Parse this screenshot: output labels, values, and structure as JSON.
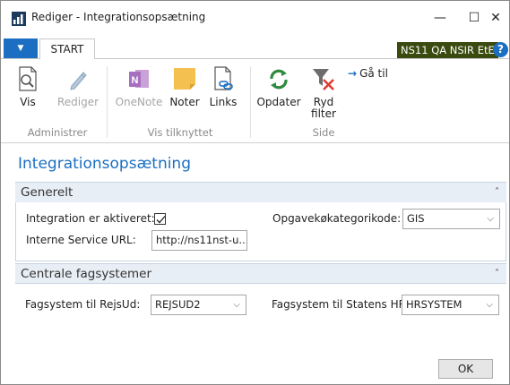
{
  "window": {
    "title": "Rediger - Integrationsopsætning",
    "minimize_glyph": "—",
    "maximize_glyph": "☐",
    "close_glyph": "✕"
  },
  "ribbon_tabs": {
    "file_glyph": "▼",
    "start_label": "START"
  },
  "company": "NS11 QA NSIR EtE",
  "help_glyph": "?",
  "ribbon": {
    "vis": "Vis",
    "rediger": "Rediger",
    "onenote": "OneNote",
    "noter": "Noter",
    "links": "Links",
    "opdater": "Opdater",
    "ryd_filter_1": "Ryd",
    "ryd_filter_2": "filter",
    "gaa_til": "Gå til",
    "goto_arrow": "→",
    "groups": {
      "administrer": "Administrer",
      "vis_tilknyttet": "Vis tilknyttet",
      "side": "Side"
    }
  },
  "page_title": "Integrationsopsætning",
  "generelt": {
    "title": "Generelt",
    "chevron": "˄",
    "integration_label": "Integration er aktiveret:",
    "integration_checked": true,
    "service_url_label": "Interne Service URL:",
    "service_url_value": "http://ns11nst-u...",
    "opgave_label": "Opgavekøkategorikode:",
    "opgave_value": "GIS"
  },
  "centrale": {
    "title": "Centrale fagsystemer",
    "chevron": "˄",
    "rejsud_label": "Fagsystem til RejsUd:",
    "rejsud_value": "REJSUD2",
    "statenshr_label": "Fagsystem til Statens HR:",
    "statenshr_value": "HRSYSTEM"
  },
  "dropdown_glyph": "⌵",
  "ok_label": "OK",
  "colors": {
    "accent_blue": "#1b6ec2",
    "company_badge": "#3b4a0f",
    "fasttab_header": "#e8eef5",
    "onenote_purple": "#7f3f98",
    "notes_yellow": "#f4c04f",
    "refresh_green": "#2e8b3e",
    "clear_filter_red": "#e03a2f"
  },
  "icons": [
    "app-icon",
    "magnifier-page-icon",
    "pencil-icon",
    "onenote-icon",
    "sticky-note-icon",
    "link-page-icon",
    "refresh-icon",
    "clear-filter-icon",
    "goto-arrow-icon",
    "help-icon",
    "checkmark-icon",
    "chevron-up-icon",
    "chevron-down-icon"
  ]
}
